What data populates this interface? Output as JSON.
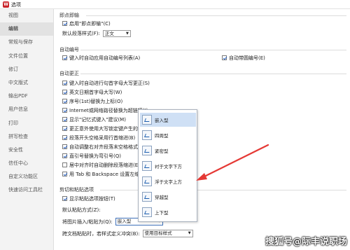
{
  "window": {
    "logo": "W",
    "title": "选项"
  },
  "sidebar": {
    "items": [
      {
        "label": "视图"
      },
      {
        "label": "编辑"
      },
      {
        "label": "常规与保存"
      },
      {
        "label": "文件位置"
      },
      {
        "label": "修订"
      },
      {
        "label": "中文版式"
      },
      {
        "label": "输出PDF"
      },
      {
        "label": "用户信息"
      },
      {
        "label": "打印"
      },
      {
        "label": "拼写检查"
      },
      {
        "label": "安全性"
      },
      {
        "label": "信任中心"
      },
      {
        "label": "自定义功能区"
      },
      {
        "label": "快速访问工具栏"
      }
    ],
    "active_index": 1
  },
  "sections": {
    "click_type": "即点即输",
    "auto_numbering": "自动编号",
    "auto_correct": "自动更正",
    "cut_paste": "剪切和粘贴选项"
  },
  "click_type": {
    "enable_label": "启用\"即点即输\"(C)",
    "enable_checked": true,
    "default_para_label": "默认段落样式(F):",
    "default_para_value": "正文"
  },
  "auto_numbering": {
    "left_label": "键入时自动应用自动编号列表(A)",
    "left_checked": true,
    "right_label": "自动带圆编号(E)",
    "right_checked": true
  },
  "auto_correct": {
    "items": [
      {
        "label": "键入时自动进行句首字母大写更正(S)",
        "checked": true
      },
      {
        "label": "英文日期首字母大写(W)",
        "checked": true
      },
      {
        "label": "序号(1st)替换为上标(O)",
        "checked": true
      },
      {
        "label": "Internet或网络路径替换为超链接(I)",
        "checked": true
      },
      {
        "label": "显示\"记忆式键入\"建议(M)",
        "checked": true
      },
      {
        "label": "更正意外使用大写锁定键产生的大",
        "checked": true
      },
      {
        "label": "段落开头空格采用行首缩进(B)",
        "checked": true
      },
      {
        "label": "自动调整右对齐段落末空格格式(",
        "checked": true
      },
      {
        "label": "直引号替换为弯引号(Q)",
        "checked": true
      },
      {
        "label": "居中对齐时自动删除段落缩进(E)",
        "checked": false
      },
      {
        "label": "用 Tab 和 Backspace 设置左缩",
        "checked": true
      }
    ]
  },
  "cut_paste": {
    "show_paste_label": "显示粘贴选项按钮(T)",
    "show_paste_checked": true,
    "default_paste_label": "默认粘贴方式(Z):",
    "insert_pic_label": "将图片插入/粘贴为(Q):",
    "insert_pic_value": "嵌入型",
    "cross_doc_label": "跨文档粘贴时，若样式定义冲突(B):",
    "cross_doc_value": "使用目标样式"
  },
  "dropdown": {
    "options": [
      {
        "label": "嵌入型"
      },
      {
        "label": "四周型"
      },
      {
        "label": "紧密型"
      },
      {
        "label": "衬于文字下方"
      },
      {
        "label": "浮于文字上方"
      },
      {
        "label": "穿越型"
      },
      {
        "label": "上下型"
      }
    ],
    "highlighted_index": 0
  },
  "colors": {
    "accent": "#2a64c5",
    "arrow": "#e53935",
    "highlight": "#cfe0f5"
  },
  "watermark": {
    "text": "搜狐号@际丰说职场"
  }
}
